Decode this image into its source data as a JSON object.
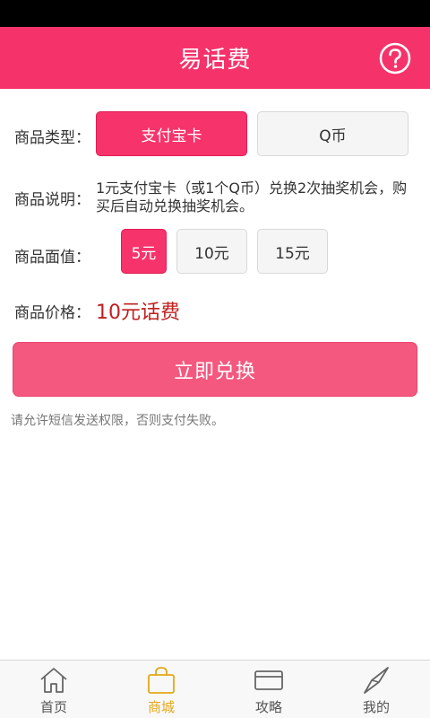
{
  "header": {
    "title": "易话费",
    "help_icon": "question-circle-icon"
  },
  "product_type": {
    "label": "商品类型：",
    "options": [
      {
        "label": "支付宝卡",
        "selected": true
      },
      {
        "label": "Q币",
        "selected": false
      }
    ]
  },
  "product_desc": {
    "label": "商品说明：",
    "text": "1元支付宝卡（或1个Q币）兑换2次抽奖机会，购买后自动兑换抽奖机会。"
  },
  "product_value": {
    "label": "商品面值：",
    "options": [
      {
        "label": "5元",
        "selected": true
      },
      {
        "label": "10元",
        "selected": false
      },
      {
        "label": "15元",
        "selected": false
      }
    ]
  },
  "product_price": {
    "label": "商品价格：",
    "value": "10元话费"
  },
  "redeem_button": {
    "label": "立即兑换"
  },
  "notice": "请允许短信发送权限，否则支付失败。",
  "tabbar": {
    "items": [
      {
        "label": "首页",
        "icon": "home-icon",
        "active": false
      },
      {
        "label": "商城",
        "icon": "shopping-bag-icon",
        "active": true
      },
      {
        "label": "攻略",
        "icon": "card-icon",
        "active": false
      },
      {
        "label": "我的",
        "icon": "compass-icon",
        "active": false
      }
    ]
  },
  "colors": {
    "primary": "#f6326a",
    "redeem": "#f4587f",
    "price": "#c01f1f",
    "tab_active": "#e3a818"
  }
}
